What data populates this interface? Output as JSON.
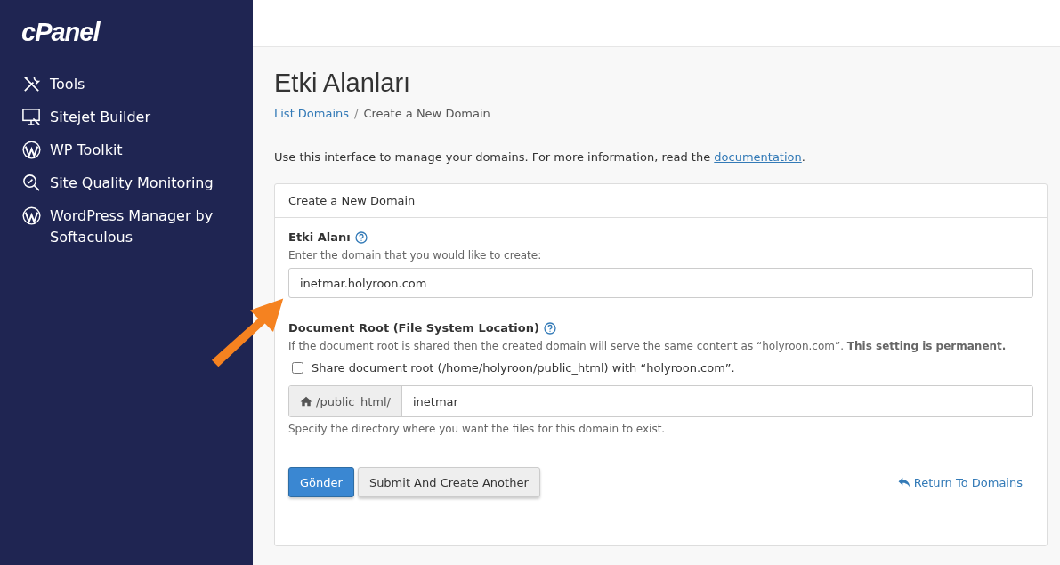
{
  "sidebar": {
    "logo": "cPanel",
    "items": [
      {
        "label": "Tools",
        "kind": "tools"
      },
      {
        "label": "Sitejet Builder",
        "kind": "monitor"
      },
      {
        "label": "WP Toolkit",
        "kind": "wordpress"
      },
      {
        "label": "Site Quality Monitoring",
        "kind": "magnifier"
      },
      {
        "label": "WordPress Manager by Softaculous",
        "kind": "wordpress"
      }
    ]
  },
  "page": {
    "title": "Etki Alanları",
    "breadcrumbs": [
      "List Domains",
      "Create a New Domain"
    ],
    "breadcrumb_separator": "/",
    "intro": {
      "text": "Use this interface to manage your domains. For more information, read the",
      "link": "documentation",
      "end": "."
    }
  },
  "panel": {
    "heading": "Create a New Domain",
    "domain": {
      "label": "Etki Alanı",
      "hint": "Enter the domain that you would like to create:",
      "value": "inetmar.holyroon.com"
    },
    "docroot": {
      "label": "Document Root (File System Location)",
      "hint": "If the document root is shared then the created domain will serve the same content as “holyroon.com”. **This setting is permanent.**",
      "share": {
        "label": "Share document root (/home/holyroon/public_html) with “holyroon.com”.",
        "checked": false
      },
      "prefix": "/public_html/",
      "value": "inetmar",
      "help": "Specify the directory where you want the files for this domain to exist."
    },
    "buttons": {
      "submit": "Gönder",
      "another": "Submit And Create Another",
      "return": "Return To Domains"
    }
  }
}
